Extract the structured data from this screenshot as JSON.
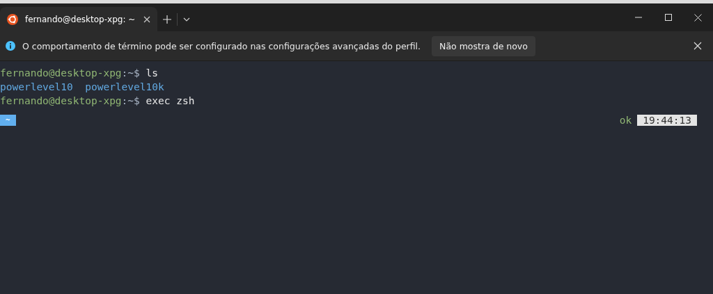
{
  "tab": {
    "title": "fernando@desktop-xpg: ~",
    "selected": true
  },
  "info_bar": {
    "message": "O comportamento de término pode ser configurado nas configurações avançadas do perfil.",
    "button": "Não mostra de novo"
  },
  "terminal": {
    "lines": [
      {
        "kind": "prompt",
        "user": "fernando@desktop-xpg",
        "path": ":~$",
        "command": "ls"
      },
      {
        "kind": "output",
        "items": [
          "powerlevel10",
          "powerlevel10k"
        ]
      },
      {
        "kind": "prompt",
        "user": "fernando@desktop-xpg",
        "path": ":~$",
        "command": "exec zsh"
      }
    ],
    "p10k_prompt": {
      "directory": "~",
      "status": "ok",
      "time": "19:44:13"
    }
  }
}
